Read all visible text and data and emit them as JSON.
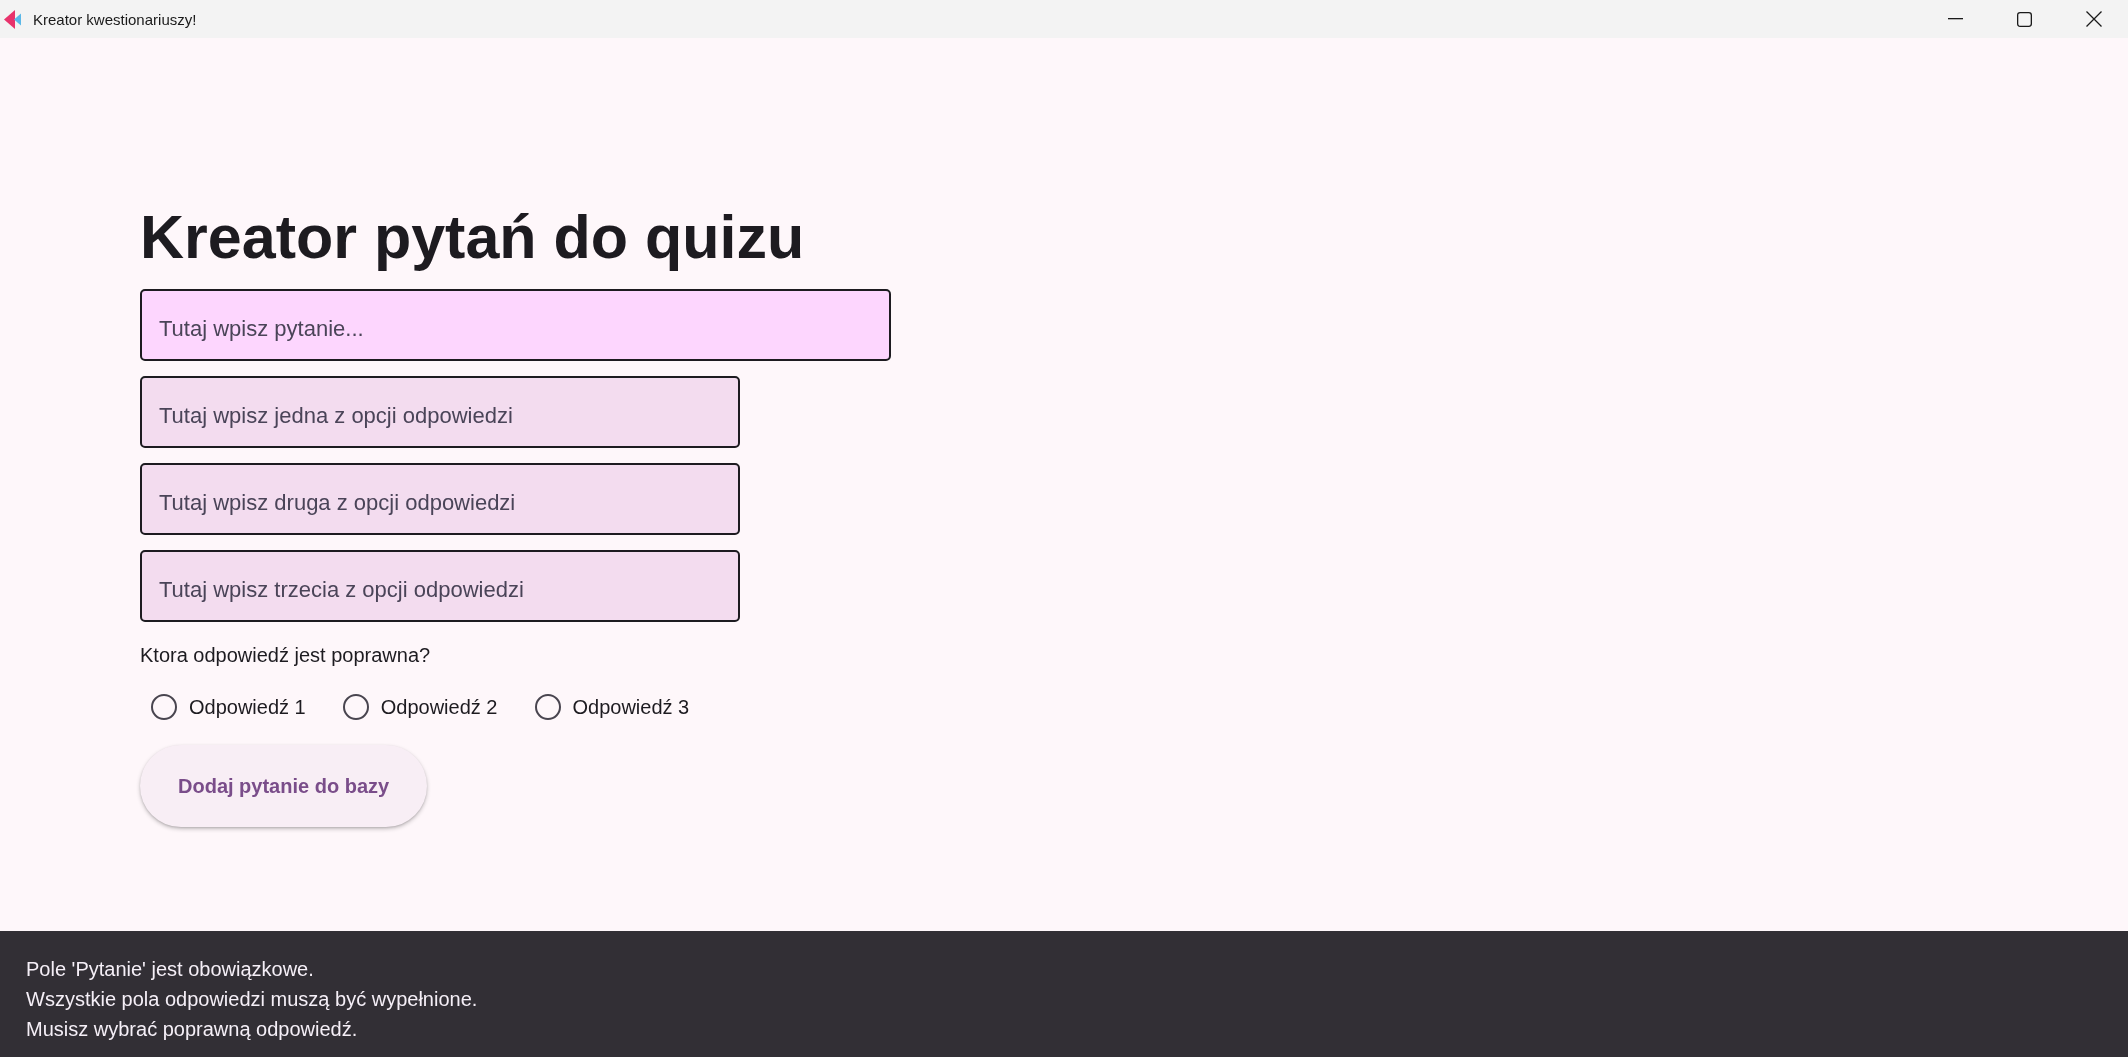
{
  "window": {
    "title": "Kreator kwestionariuszy!"
  },
  "heading": "Kreator pytań do quizu",
  "fields": [
    {
      "kind": "question",
      "placeholder": "Tutaj wpisz pytanie..."
    },
    {
      "kind": "answer",
      "placeholder": "Tutaj wpisz jedna z opcji odpowiedzi"
    },
    {
      "kind": "answer",
      "placeholder": "Tutaj wpisz druga z opcji odpowiedzi"
    },
    {
      "kind": "answer",
      "placeholder": "Tutaj wpisz trzecia z opcji odpowiedzi"
    }
  ],
  "correct_answer": {
    "label": "Ktora odpowiedź jest poprawna?",
    "options": [
      {
        "label": "Odpowiedź 1",
        "selected": false
      },
      {
        "label": "Odpowiedź 2",
        "selected": false
      },
      {
        "label": "Odpowiedź 3",
        "selected": false
      }
    ]
  },
  "submit_button": {
    "label": "Dodaj pytanie do bazy"
  },
  "snackbar": {
    "lines": [
      "Pole 'Pytanie' jest obowiązkowe.",
      "Wszystkie pola odpowiedzi muszą być wypełnione.",
      "Musisz wybrać poprawną odpowiedź."
    ]
  }
}
